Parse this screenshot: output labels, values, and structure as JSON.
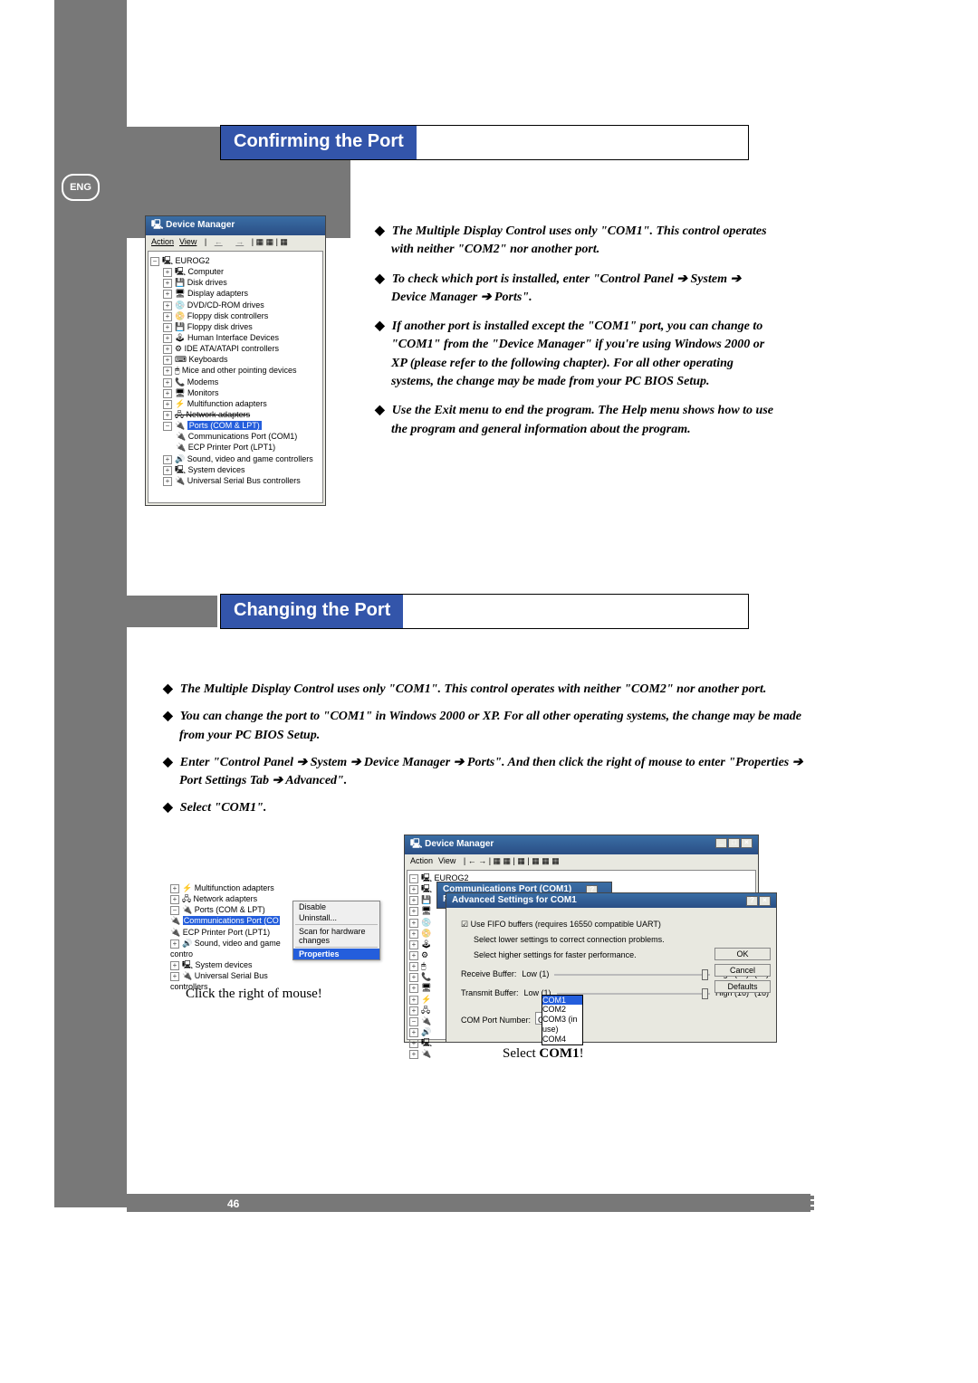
{
  "lang_badge": "ENG",
  "section1_title": "Confirming the Port",
  "devmgr": {
    "title": "Device Manager",
    "menu_action": "Action",
    "menu_view": "View",
    "root": "EUROG2",
    "items": [
      "Computer",
      "Disk drives",
      "Display adapters",
      "DVD/CD-ROM drives",
      "Floppy disk controllers",
      "Floppy disk drives",
      "Human Interface Devices",
      "IDE ATA/ATAPI controllers",
      "Keyboards",
      "Mice and other pointing devices",
      "Modems",
      "Monitors",
      "Multifunction adapters",
      "Network adapters"
    ],
    "ports": "Ports (COM & LPT)",
    "port_com1": "Communications Port (COM1)",
    "port_lpt1": "ECP Printer Port (LPT1)",
    "tail": [
      "Sound, video and game controllers",
      "System devices",
      "Universal Serial Bus controllers"
    ]
  },
  "section1_bullets": [
    "The Multiple Display Control uses only \"COM1\". This control operates with neither \"COM2\" nor another port.",
    "To check which port is installed, enter \"Control Panel ➔ System ➔ Device Manager ➔ Ports\".",
    "If another port is installed except the \"COM1\" port, you can change to \"COM1\" from the \"Device Manager\" if you're using Windows 2000 or XP (please refer to the following chapter). For all other operating systems, the change may be made from your PC BIOS Setup.",
    "Use the Exit menu to end the program. The Help menu shows how to use the program and general information about the program."
  ],
  "section2_title": "Changing the Port",
  "section2_bullets": [
    "The Multiple Display Control uses only \"COM1\". This control operates with neither \"COM2\" nor another port.",
    "You can change the port to \"COM1\" in Windows 2000 or XP. For all other operating systems, the change may be made from your PC BIOS Setup.",
    "Enter \"Control Panel ➔ System ➔ Device Manager ➔ Ports\". And then click the right of mouse to enter \"Properties ➔ Port Settings Tab ➔ Advanced\".",
    "Select \"COM1\"."
  ],
  "ctx": {
    "tree": [
      "Multifunction adapters",
      "Network adapters",
      "Ports (COM & LPT)"
    ],
    "sel_item": "Communications Port (CO",
    "lpt": "ECP Printer Port (LPT1)",
    "tail": [
      "Sound, video and game contro",
      "System devices",
      "Universal Serial Bus controllers"
    ],
    "menu": {
      "disable": "Disable",
      "uninstall": "Uninstall...",
      "scan": "Scan for hardware changes",
      "props": "Properties"
    },
    "caption": "Click the right of mouse!"
  },
  "dlg2": {
    "outer_title": "Device Manager",
    "menu_action": "Action",
    "menu_view": "View",
    "root": "EUROG2",
    "props_title": "Communications Port (COM1) Properties",
    "adv_title": "Advanced Settings for COM1",
    "use_fifo": "Use FIFO buffers (requires 16550 compatible UART)",
    "hint1": "Select lower settings to correct connection problems.",
    "hint2": "Select higher settings for faster performance.",
    "recv": "Receive Buffer:",
    "low": "Low (1)",
    "high14": "High (14)",
    "v14": "(14)",
    "trans": "Transmit Buffer:",
    "high16": "High (16)",
    "v16": "(16)",
    "comport": "COM Port Number:",
    "combo_val": "COM3",
    "opts": [
      "COM1",
      "COM2",
      "COM3 (in use)",
      "COM4"
    ],
    "ok": "OK",
    "cancel": "Cancel",
    "defaults": "Defaults",
    "caption_pre": "Select ",
    "caption_bold": "COM1",
    "caption_post": "!"
  },
  "page_number": "46"
}
